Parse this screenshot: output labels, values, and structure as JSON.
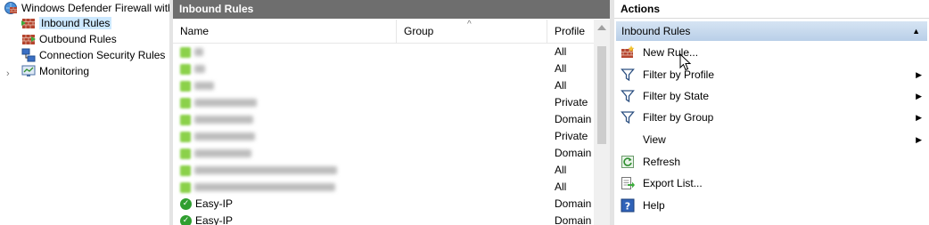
{
  "tree": {
    "root_label": "Windows Defender Firewall with",
    "items": [
      {
        "label": "Inbound Rules",
        "icon": "inbound-rules-icon",
        "selected": true
      },
      {
        "label": "Outbound Rules",
        "icon": "outbound-rules-icon",
        "selected": false
      },
      {
        "label": "Connection Security Rules",
        "icon": "connection-security-icon",
        "selected": false
      },
      {
        "label": "Monitoring",
        "icon": "monitoring-icon",
        "selected": false
      }
    ],
    "expander": "›"
  },
  "center": {
    "title": "Inbound Rules",
    "columns": {
      "name": "Name",
      "group": "Group",
      "profile": "Profile"
    },
    "sort_indicator": "^",
    "rows": [
      {
        "name": "",
        "profile": "All"
      },
      {
        "name": "",
        "profile": "All"
      },
      {
        "name": "",
        "profile": "All"
      },
      {
        "name": "",
        "profile": "Private"
      },
      {
        "name": "",
        "profile": "Domain"
      },
      {
        "name": "",
        "profile": "Private"
      },
      {
        "name": "",
        "profile": "Domain"
      },
      {
        "name": "",
        "profile": "All"
      },
      {
        "name": "",
        "profile": "All"
      },
      {
        "name": "Easy-IP",
        "profile": "Domain"
      },
      {
        "name": "Easy-IP",
        "profile": "Domain"
      }
    ]
  },
  "actions": {
    "title": "Actions",
    "group_label": "Inbound Rules",
    "group_collapse": "▲",
    "items": [
      {
        "label": "New Rule...",
        "icon": "new-rule-icon",
        "submenu": false
      },
      {
        "label": "Filter by Profile",
        "icon": "filter-icon",
        "submenu": true
      },
      {
        "label": "Filter by State",
        "icon": "filter-icon",
        "submenu": true
      },
      {
        "label": "Filter by Group",
        "icon": "filter-icon",
        "submenu": true
      },
      {
        "label": "View",
        "icon": "",
        "submenu": true
      },
      {
        "label": "Refresh",
        "icon": "refresh-icon",
        "submenu": false
      },
      {
        "label": "Export List...",
        "icon": "export-icon",
        "submenu": false
      },
      {
        "label": "Help",
        "icon": "help-icon",
        "submenu": false
      }
    ],
    "submenu_arrow": "▶"
  },
  "colors": {
    "center_header": "#6e6e6e",
    "selection": "#cce8ff",
    "group_header": "#c7d9ee",
    "ok_green": "#2f9e2f"
  }
}
